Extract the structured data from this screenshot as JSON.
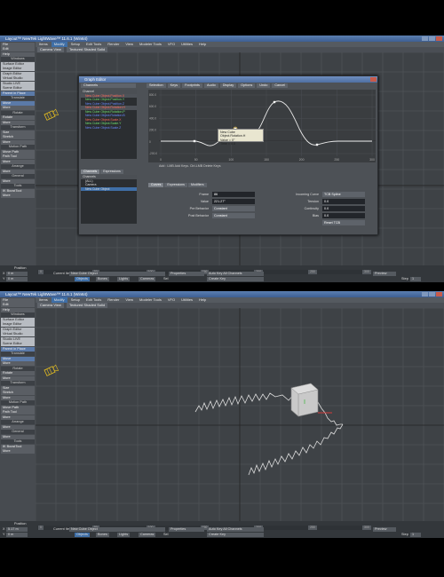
{
  "app": {
    "title": "Layout™ NewTek LightWave™ 11.6.1 (Win64)",
    "menu": [
      "Items",
      "Modify",
      "Setup",
      "Edit Tools",
      "Render",
      "View",
      "Modeler Tools",
      "VFO",
      "Utilities",
      "Help"
    ],
    "toolbar": [
      "Camera View",
      "Textured Shaded Solid"
    ]
  },
  "sidebar": {
    "items": [
      {
        "label": "File",
        "style": "plain"
      },
      {
        "label": "Edit",
        "style": "plain"
      },
      {
        "label": "Help",
        "style": "plain"
      },
      {
        "label": "Windows",
        "style": "head"
      },
      {
        "label": "Surface Editor",
        "style": "light"
      },
      {
        "label": "Image Editor",
        "style": "light"
      },
      {
        "label": "Graph Editor",
        "style": "light"
      },
      {
        "label": "Virtual Studio",
        "style": "light"
      },
      {
        "label": "Studio LIVE",
        "style": "light"
      },
      {
        "label": "Scene Editor",
        "style": "light"
      },
      {
        "label": "Parent in Place",
        "style": "blue"
      },
      {
        "label": "Translate",
        "style": "head"
      },
      {
        "label": "Move",
        "style": "blue"
      },
      {
        "label": "More",
        "style": "plain"
      },
      {
        "label": "Rotate",
        "style": "head"
      },
      {
        "label": "Rotate",
        "style": "plain"
      },
      {
        "label": "More",
        "style": "plain"
      },
      {
        "label": "Transform",
        "style": "head"
      },
      {
        "label": "Size",
        "style": "plain"
      },
      {
        "label": "Stretch",
        "style": "plain"
      },
      {
        "label": "More",
        "style": "plain"
      },
      {
        "label": "Motion Path",
        "style": "head"
      },
      {
        "label": "Move Path",
        "style": "plain"
      },
      {
        "label": "Path Tool",
        "style": "plain"
      },
      {
        "label": "More",
        "style": "plain"
      },
      {
        "label": "Arrange",
        "style": "head"
      },
      {
        "label": "More",
        "style": "plain"
      },
      {
        "label": "General",
        "style": "head"
      },
      {
        "label": "More",
        "style": "plain"
      },
      {
        "label": "Tools",
        "style": "head"
      },
      {
        "label": "IK BoostTool",
        "style": "plain"
      },
      {
        "label": "More",
        "style": "plain"
      }
    ]
  },
  "bottom": {
    "position_label": "Position",
    "shot1": {
      "x": "0 m",
      "y": "0 m",
      "z": "0 m",
      "grid": "1 m"
    },
    "shot2": {
      "x": "5.17 m",
      "y": "0 m",
      "z": "727.978 mm",
      "grid": "1 m"
    },
    "current_item_label": "Current Item",
    "current_item": "New Cube Object",
    "buttons": [
      "Objects",
      "Bones",
      "Lights",
      "Cameras",
      "Sel",
      "Properties"
    ],
    "autokey": "Auto Key  All Channels",
    "create_key": "Create Key",
    "delete_key": "Delete Key",
    "status": "Drag mouse in view to move selected items. ALT while dragging snaps to ite",
    "preview": "Preview",
    "step_label": "Step",
    "step": "1",
    "undo": "Undo",
    "frame1": "0",
    "frame2": "171",
    "timeline_labels": [
      "0",
      "50",
      "100",
      "150",
      "200",
      "250",
      "300"
    ]
  },
  "graph_editor": {
    "title": "Graph Editor",
    "menu": [
      "Channels",
      "Selection",
      "Keys",
      "Footprints",
      "Audio",
      "Display",
      "Options",
      "Undo",
      "Cancel"
    ],
    "channels_header": "Channel",
    "channels": [
      {
        "label": "New Cube Object.Position.X",
        "color": "#ff6a5a",
        "selected": true
      },
      {
        "label": "New Cube Object.Position.Y",
        "color": "#6fe06f",
        "selected": false
      },
      {
        "label": "New Cube Object.Position.Z",
        "color": "#6a8aff",
        "selected": false
      },
      {
        "label": "New Cube Object.Rotation.H",
        "color": "#ff6a5a",
        "selected": true
      },
      {
        "label": "New Cube Object.Rotation.P",
        "color": "#6fe06f",
        "selected": false
      },
      {
        "label": "New Cube Object.Rotation.B",
        "color": "#6a8aff",
        "selected": false
      },
      {
        "label": "New Cube Object.Scale.X",
        "color": "#ff6a5a",
        "selected": false
      },
      {
        "label": "New Cube Object.Scale.Y",
        "color": "#6fe06f",
        "selected": false
      },
      {
        "label": "New Cube Object.Scale.Z",
        "color": "#6a8aff",
        "selected": false
      }
    ],
    "tree_tabs": [
      "Channels",
      "Expressions"
    ],
    "tree_header": "Channels",
    "tree": [
      "(ALL)",
      "Camera",
      "New Cube Object"
    ],
    "hint": "Add :  LMB Add Keys. Ctrl-LMB Delete Keys",
    "tabs": [
      "Curves",
      "Expressions",
      "Modifiers"
    ],
    "fields": [
      {
        "label": "Frame",
        "value": "86"
      },
      {
        "label": "Value",
        "value": "221.27°"
      },
      {
        "label": "Pre Behavior",
        "value": "Constant"
      },
      {
        "label": "Post Behavior",
        "value": "Constant"
      }
    ],
    "fields_right": [
      {
        "label": "Incoming Curve",
        "value": "TCB Spline"
      },
      {
        "label": "Tension",
        "value": "0.0"
      },
      {
        "label": "Continuity",
        "value": "0.0"
      },
      {
        "label": "Bias",
        "value": "0.0"
      },
      {
        "label": "",
        "value": "Reset TCB"
      }
    ],
    "tooltip": [
      "New Cube Object.Rotation.H",
      "Value = 0°",
      "Time = 0.0"
    ],
    "x_labels": [
      "0",
      "50",
      "100",
      "150",
      "200",
      "250",
      "300"
    ],
    "y_labels": [
      "800.0",
      "600.0",
      "400.0",
      "200.0",
      "0",
      "-200.0"
    ]
  }
}
